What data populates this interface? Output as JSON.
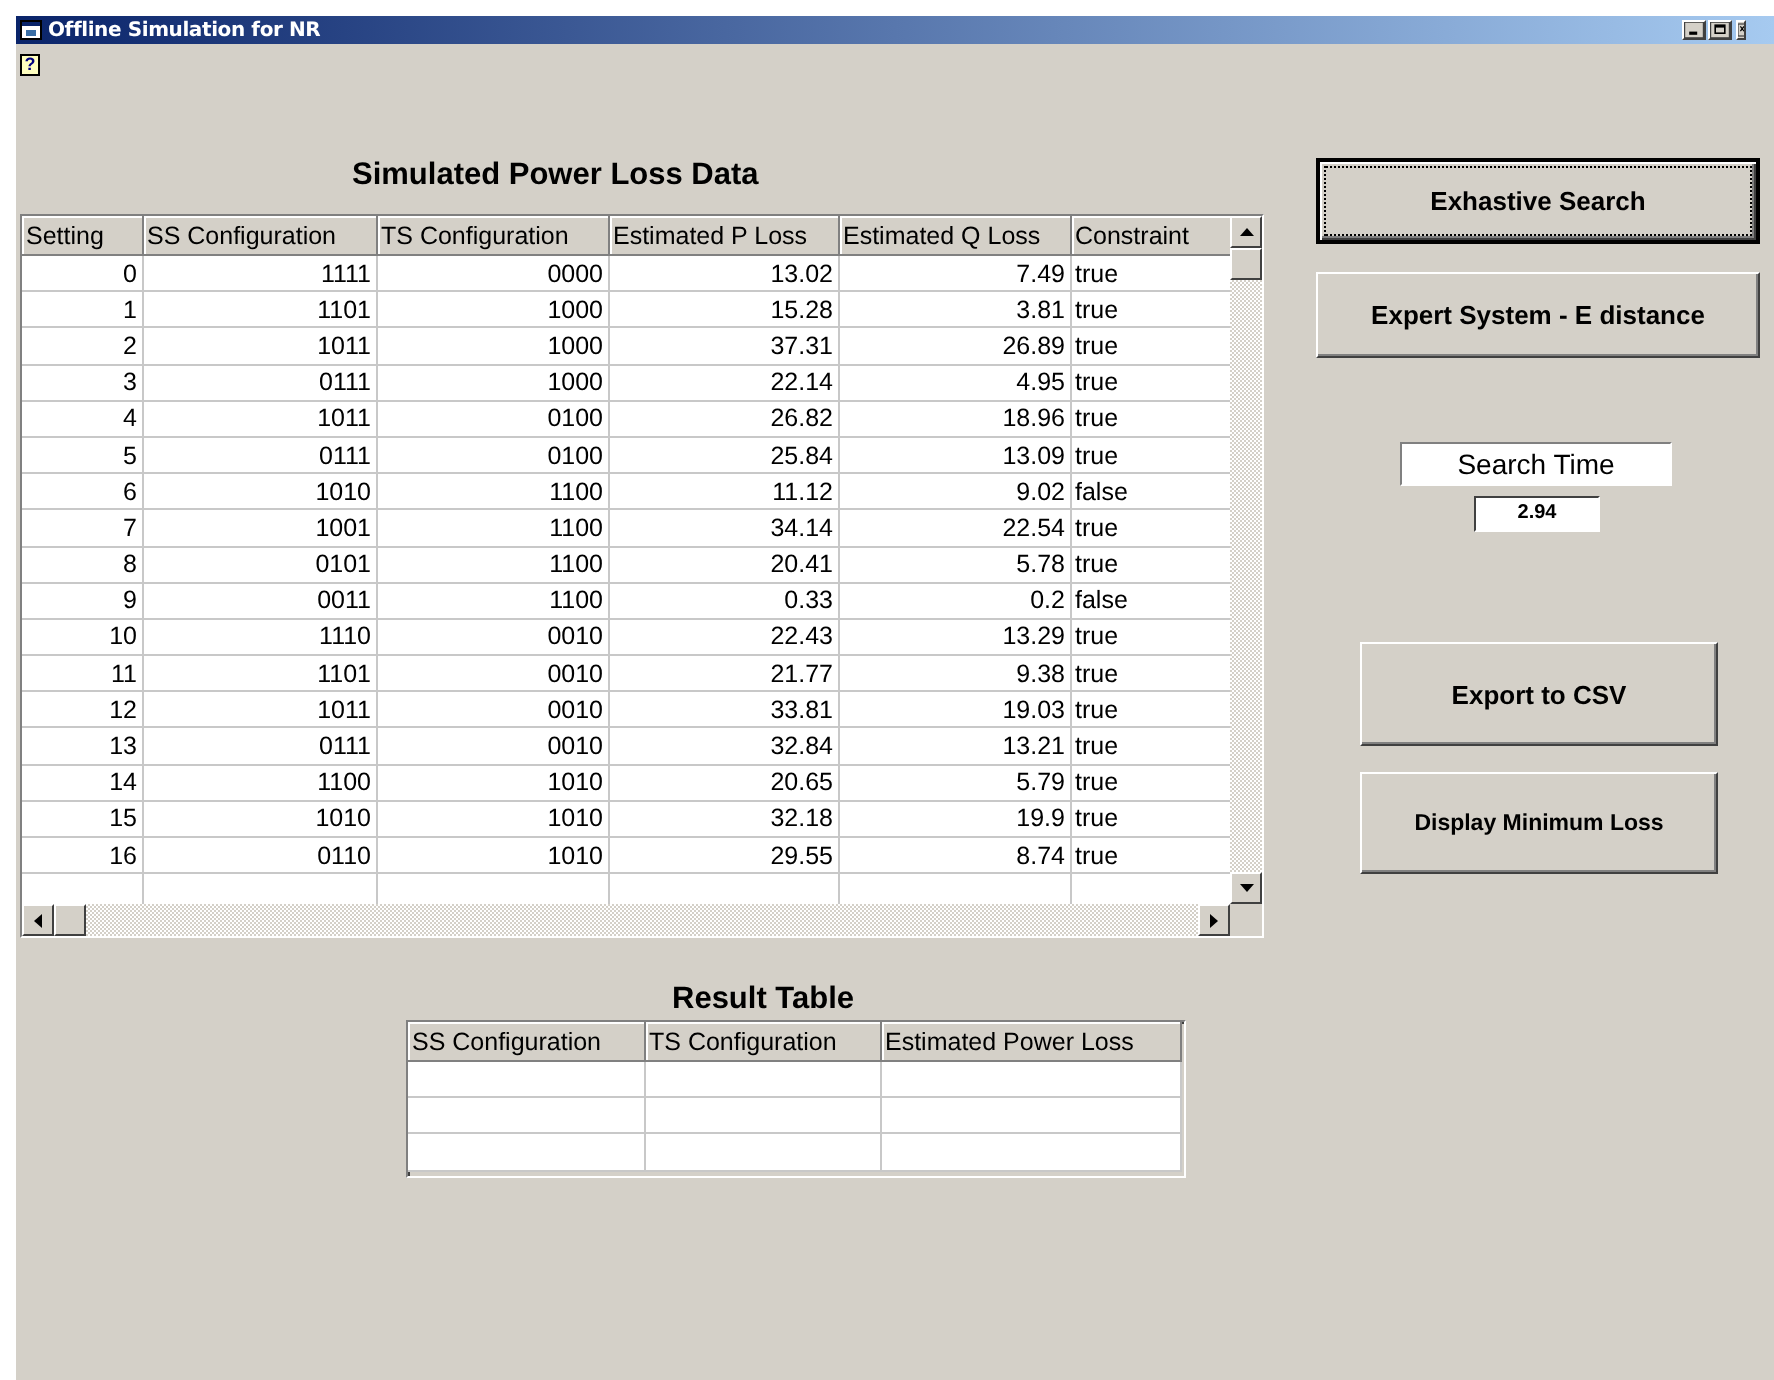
{
  "window": {
    "title": "Offline Simulation for NR"
  },
  "help_button": "?",
  "loss_table": {
    "title": "Simulated Power Loss Data",
    "columns": [
      "Setting",
      "SS Configuration",
      "TS Configuration",
      "Estimated P Loss",
      "Estimated Q Loss",
      "Constraint"
    ],
    "rows": [
      [
        "0",
        "1111",
        "0000",
        "13.02",
        "7.49",
        "true"
      ],
      [
        "1",
        "1101",
        "1000",
        "15.28",
        "3.81",
        "true"
      ],
      [
        "2",
        "1011",
        "1000",
        "37.31",
        "26.89",
        "true"
      ],
      [
        "3",
        "0111",
        "1000",
        "22.14",
        "4.95",
        "true"
      ],
      [
        "4",
        "1011",
        "0100",
        "26.82",
        "18.96",
        "true"
      ],
      [
        "5",
        "0111",
        "0100",
        "25.84",
        "13.09",
        "true"
      ],
      [
        "6",
        "1010",
        "1100",
        "11.12",
        "9.02",
        "false"
      ],
      [
        "7",
        "1001",
        "1100",
        "34.14",
        "22.54",
        "true"
      ],
      [
        "8",
        "0101",
        "1100",
        "20.41",
        "5.78",
        "true"
      ],
      [
        "9",
        "0011",
        "1100",
        "0.33",
        "0.2",
        "false"
      ],
      [
        "10",
        "1110",
        "0010",
        "22.43",
        "13.29",
        "true"
      ],
      [
        "11",
        "1101",
        "0010",
        "21.77",
        "9.38",
        "true"
      ],
      [
        "12",
        "1011",
        "0010",
        "33.81",
        "19.03",
        "true"
      ],
      [
        "13",
        "0111",
        "0010",
        "32.84",
        "13.21",
        "true"
      ],
      [
        "14",
        "1100",
        "1010",
        "20.65",
        "5.79",
        "true"
      ],
      [
        "15",
        "1010",
        "1010",
        "32.18",
        "19.9",
        "true"
      ],
      [
        "16",
        "0110",
        "1010",
        "29.55",
        "8.74",
        "true"
      ]
    ]
  },
  "buttons": [
    {
      "label": "Exhastive Search",
      "focused": true
    },
    {
      "label": "Expert System - E distance",
      "focused": false
    }
  ],
  "search_time": {
    "label": "Search Time",
    "value": "2.94"
  },
  "action_buttons": [
    {
      "label": "Export to CSV",
      "focused": false
    },
    {
      "label": "Display Minimum Loss",
      "focused": false
    }
  ],
  "result_table": {
    "title": "Result Table",
    "columns": [
      "SS Configuration",
      "TS Configuration",
      "Estimated Power Loss"
    ]
  }
}
